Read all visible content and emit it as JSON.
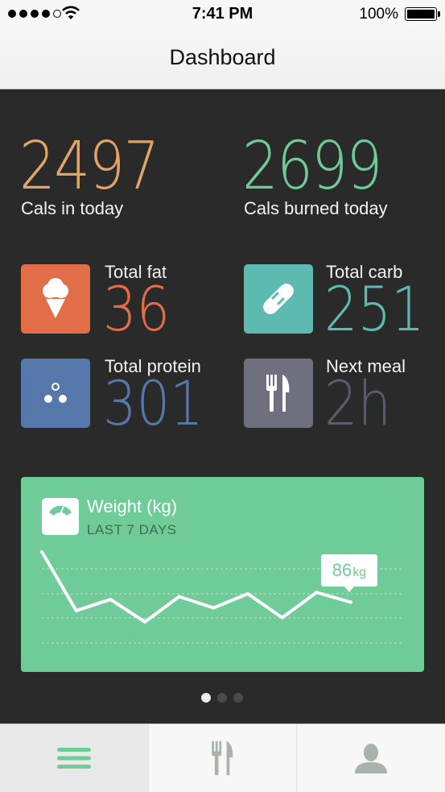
{
  "status_bar": {
    "time": "7:41 PM",
    "battery": "100%",
    "signal_bars": 5,
    "signal_filled": 4
  },
  "navbar": {
    "title": "Dashboard"
  },
  "summary": {
    "cals_in": {
      "value": "2497",
      "label": "Cals in today",
      "color": "#e0a566"
    },
    "cals_burned": {
      "value": "2699",
      "label": "Cals burned today",
      "color": "#6ecb97"
    }
  },
  "tiles": [
    {
      "label": "Total fat",
      "value": "36",
      "icon": "ice-cream-icon",
      "color": "#e16e47"
    },
    {
      "label": "Total carb",
      "value": "251",
      "icon": "bread-icon",
      "color": "#5dbab0"
    },
    {
      "label": "Total protein",
      "value": "301",
      "icon": "dots-icon",
      "color": "#5677aa"
    },
    {
      "label": "Next meal",
      "value": "2h",
      "icon": "fork-knife-icon",
      "color": "#6e7080"
    }
  ],
  "weight_card": {
    "title": "Weight (kg)",
    "subtitle": "LAST 7 DAYS",
    "current_value": "86",
    "current_unit": "kg",
    "background": "#6fcb97"
  },
  "chart_data": {
    "type": "line",
    "y": [
      89.5,
      85.3,
      86.1,
      84.5,
      86.3,
      85.5,
      86.5,
      84.8,
      86.6,
      85.9
    ]
  },
  "pager": {
    "pages": 3,
    "active": 0
  },
  "tabbar": {
    "tabs": [
      {
        "icon": "menu-icon",
        "active": true
      },
      {
        "icon": "fork-knife-icon",
        "active": false
      },
      {
        "icon": "profile-icon",
        "active": false
      }
    ]
  }
}
